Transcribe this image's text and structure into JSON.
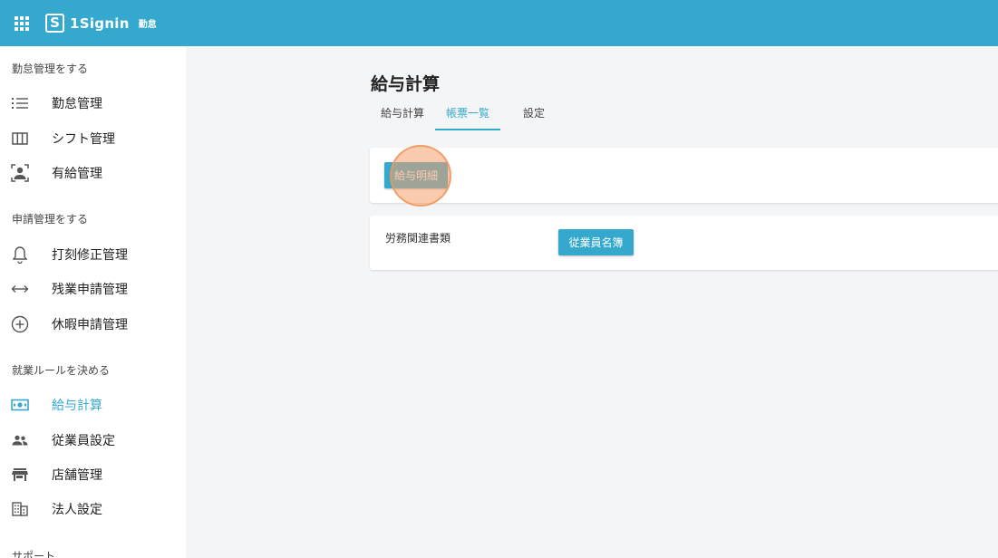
{
  "header": {
    "logo_mark": "S",
    "app_name": "1Signin",
    "app_sub": "勤怠"
  },
  "sidebar": {
    "sections": [
      {
        "title": "勤怠管理をする",
        "items": [
          {
            "label": "勤怠管理",
            "icon": "list-icon"
          },
          {
            "label": "シフト管理",
            "icon": "columns-icon"
          },
          {
            "label": "有給管理",
            "icon": "person-frame-icon"
          }
        ]
      },
      {
        "title": "申請管理をする",
        "items": [
          {
            "label": "打刻修正管理",
            "icon": "bell-icon"
          },
          {
            "label": "残業申請管理",
            "icon": "double-arrow-icon"
          },
          {
            "label": "休暇申請管理",
            "icon": "plus-circle-icon"
          }
        ]
      },
      {
        "title": "就業ルールを決める",
        "items": [
          {
            "label": "給与計算",
            "icon": "money-icon",
            "active": true
          },
          {
            "label": "従業員設定",
            "icon": "people-icon"
          },
          {
            "label": "店舗管理",
            "icon": "store-icon"
          },
          {
            "label": "法人設定",
            "icon": "building-icon"
          }
        ]
      },
      {
        "title": "サポート",
        "items": []
      }
    ]
  },
  "main": {
    "title": "給与計算",
    "tabs": [
      {
        "label": "給与計算",
        "active": false
      },
      {
        "label": "帳票一覧",
        "active": true
      },
      {
        "label": "設定",
        "active": false
      }
    ],
    "card1": {
      "button_label": "給与明細"
    },
    "card2": {
      "label": "労務関連書類",
      "button_label": "従業員名簿"
    }
  },
  "colors": {
    "accent": "#35a9cd",
    "click_marker": "#f6a06e"
  }
}
